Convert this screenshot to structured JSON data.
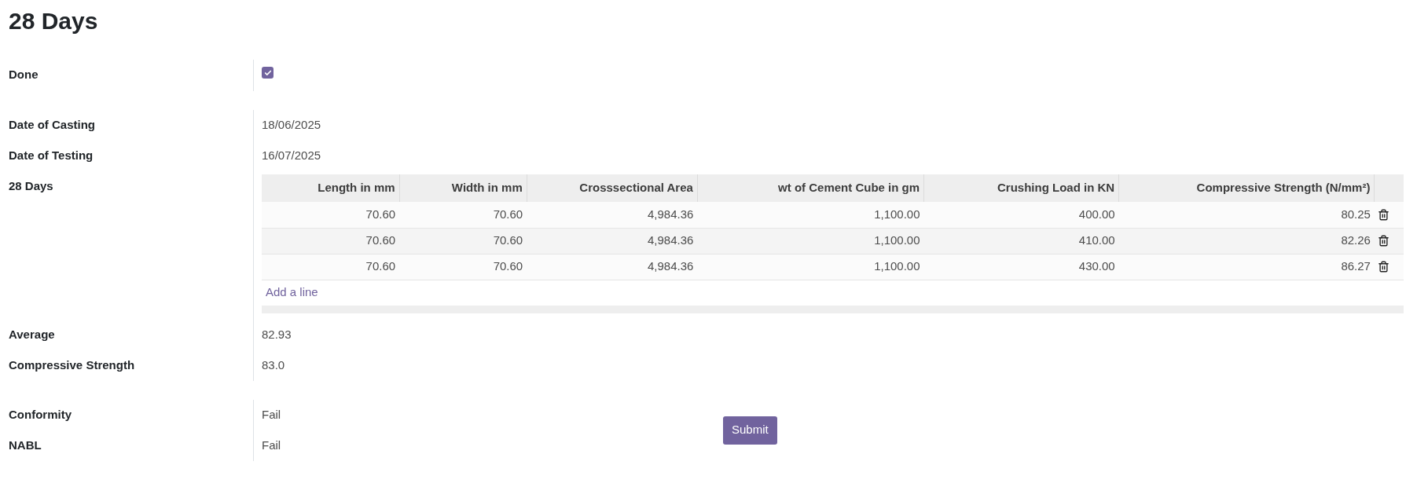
{
  "title": "28 Days",
  "sections": [
    {
      "fields": [
        {
          "kind": "checkbox",
          "label": "Done",
          "checked": true
        }
      ]
    },
    {
      "fields": [
        {
          "kind": "text",
          "label": "Date of Casting",
          "value": "18/06/2025"
        },
        {
          "kind": "text",
          "label": "Date of Testing",
          "value": "16/07/2025"
        },
        {
          "kind": "table",
          "label": "28 Days",
          "columns": [
            "Length in mm",
            "Width in mm",
            "Crosssectional Area",
            "wt of Cement Cube in gm",
            "Crushing Load in KN",
            "Compressive Strength (N/mm²)"
          ],
          "rows": [
            [
              "70.60",
              "70.60",
              "4,984.36",
              "1,100.00",
              "400.00",
              "80.25"
            ],
            [
              "70.60",
              "70.60",
              "4,984.36",
              "1,100.00",
              "410.00",
              "82.26"
            ],
            [
              "70.60",
              "70.60",
              "4,984.36",
              "1,100.00",
              "430.00",
              "86.27"
            ]
          ],
          "add_line": "Add a line"
        },
        {
          "kind": "text",
          "label": "Average",
          "value": "82.93"
        },
        {
          "kind": "text",
          "label": "Compressive Strength",
          "value": "83.0"
        }
      ]
    },
    {
      "fields": [
        {
          "kind": "text",
          "label": "Conformity",
          "value": "Fail"
        },
        {
          "kind": "text",
          "label": "NABL",
          "value": "Fail"
        }
      ],
      "button": "Submit"
    }
  ]
}
